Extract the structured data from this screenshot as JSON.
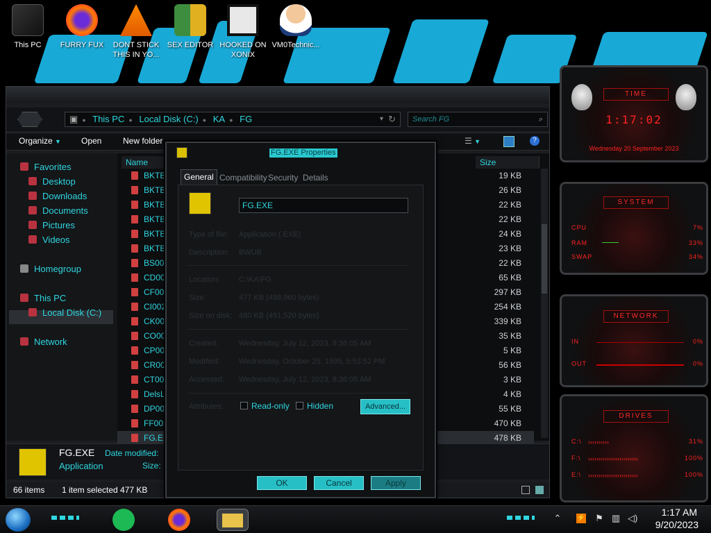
{
  "desktop": {
    "icons": [
      {
        "label": "This PC",
        "icon": "computer-icon"
      },
      {
        "label": "FURRY FUX",
        "icon": "firefox-icon"
      },
      {
        "label": "DONT STICK THIS IN YO...",
        "icon": "vlc-icon"
      },
      {
        "label": "SEX EDITOR",
        "icon": "xd-editor-icon"
      },
      {
        "label": "HOOKED ON XONIX",
        "icon": "game-icon"
      },
      {
        "label": "VM0Technic...",
        "icon": "doctor-icon"
      }
    ]
  },
  "explorer": {
    "address": {
      "segments": [
        "This PC",
        "Local Disk (C:)",
        "KA",
        "FG"
      ]
    },
    "search_placeholder": "Search FG",
    "toolbar": {
      "organize": "Organize",
      "open": "Open",
      "new_folder": "New folder"
    },
    "nav": {
      "favorites": "Favorites",
      "desktop": "Desktop",
      "downloads": "Downloads",
      "documents": "Documents",
      "pictures": "Pictures",
      "videos": "Videos",
      "homegroup": "Homegroup",
      "this_pc": "This PC",
      "local_disk": "Local Disk (C:)",
      "network": "Network"
    },
    "columns": {
      "name": "Name",
      "size": "Size"
    },
    "files": [
      {
        "name": "BKTE",
        "size": "19 KB"
      },
      {
        "name": "BKTB",
        "size": "26 KB"
      },
      {
        "name": "BKTB",
        "size": "22 KB"
      },
      {
        "name": "BKTB",
        "size": "22 KB"
      },
      {
        "name": "BKTB",
        "size": "24 KB"
      },
      {
        "name": "BKTB",
        "size": "23 KB"
      },
      {
        "name": "BS002",
        "size": "22 KB"
      },
      {
        "name": "CD002",
        "size": "65 KB"
      },
      {
        "name": "CF002",
        "size": "297 KB"
      },
      {
        "name": "CI002",
        "size": "254 KB"
      },
      {
        "name": "CK002",
        "size": "339 KB"
      },
      {
        "name": "CO00",
        "size": "35 KB"
      },
      {
        "name": "CP002",
        "size": "5 KB"
      },
      {
        "name": "CR002",
        "size": "56 KB"
      },
      {
        "name": "CT002",
        "size": "3 KB"
      },
      {
        "name": "DelsL",
        "size": "4 KB"
      },
      {
        "name": "DP002",
        "size": "55 KB"
      },
      {
        "name": "FF002",
        "size": "470 KB"
      },
      {
        "name": "FG.EX",
        "size": "478 KB"
      }
    ],
    "details": {
      "name": "FG.EXE",
      "type": "Application",
      "date_modified": "Date modified:",
      "size": "Size:"
    },
    "status": {
      "items": "66 items",
      "selected": "1 item selected  477 KB"
    }
  },
  "dialog": {
    "title": "FG.EXE Properties",
    "tabs": [
      "General",
      "Compatibility",
      "Security",
      "Details"
    ],
    "filename": "FG.EXE",
    "props": {
      "type_label": "Type of file:",
      "type_value": "Application (.EXE)",
      "desc_label": "Description:",
      "desc_value": "BWUB",
      "loc_label": "Location:",
      "loc_value": "C:\\KA\\FG",
      "size_label": "Size:",
      "size_value": "477 KB (488,960 bytes)",
      "disk_label": "Size on disk:",
      "disk_value": "480 KB (491,520 bytes)",
      "created_label": "Created:",
      "created_value": "Wednesday, July 12, 2023, 8:36:05 AM",
      "modified_label": "Modified:",
      "modified_value": "Wednesday, October 25, 1995, 5:53:52 PM",
      "accessed_label": "Accessed:",
      "accessed_value": "Wednesday, July 12, 2023, 8:36:05 AM",
      "attr_label": "Attributes:"
    },
    "readonly": "Read-only",
    "hidden": "Hidden",
    "advanced": "Advanced...",
    "ok": "OK",
    "cancel": "Cancel",
    "apply": "Apply"
  },
  "gadgets": {
    "time": {
      "title": "TIME",
      "clock": "1:17:02",
      "date": "Wednesday 20 September 2023"
    },
    "system": {
      "title": "SYSTEM",
      "cpu": "CPU",
      "cpu_val": "7%",
      "ram": "RAM",
      "ram_val": "33%",
      "swap": "SWAP",
      "swap_val": "34%"
    },
    "network": {
      "title": "NETWORK",
      "in": "IN",
      "in_val": "0%",
      "out": "OUT",
      "out_val": "0%"
    },
    "drives": {
      "title": "DRIVES",
      "c": "C:\\",
      "c_val": "31%",
      "f": "F:\\",
      "f_val": "100%",
      "e": "E:\\",
      "e_val": "100%"
    }
  },
  "taskbar": {
    "time": "1:17 AM",
    "date": "9/20/2023"
  }
}
